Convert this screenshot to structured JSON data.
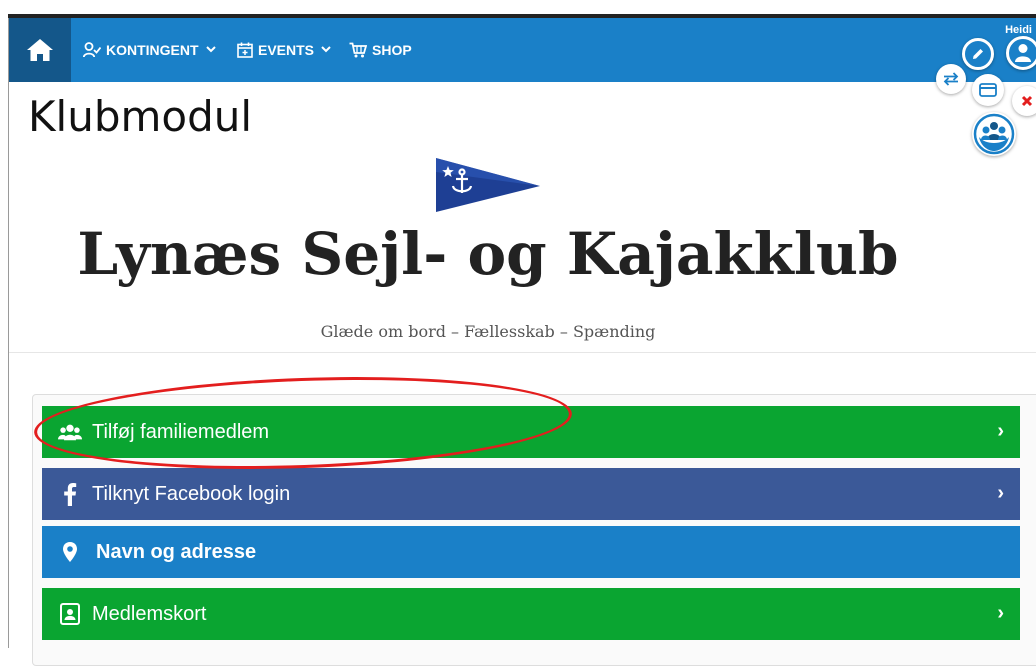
{
  "nav": {
    "items": [
      {
        "label": "KONTINGENT",
        "icon": "user-check-icon",
        "has_dropdown": true
      },
      {
        "label": "EVENTS",
        "icon": "calendar-icon",
        "has_dropdown": true
      },
      {
        "label": "SHOP",
        "icon": "cart-icon",
        "has_dropdown": false
      }
    ],
    "user_name": "Heidi"
  },
  "page": {
    "module_title": "Klubmodul",
    "club_name": "Lynæs Sejl- og Kajakklub",
    "tagline": "Glæde om bord – Fællesskab – Spænding"
  },
  "menu": [
    {
      "label": "Tilføj familiemedlem",
      "icon": "family-icon",
      "color": "#0aa531",
      "arrow": "›"
    },
    {
      "label": "Tilknyt Facebook login",
      "icon": "facebook-icon",
      "color": "#3b5998",
      "arrow": "›"
    },
    {
      "label": "Navn og adresse",
      "icon": "map-pin-icon",
      "color": "#1a80c8",
      "arrow": ""
    },
    {
      "label": "Medlemskort",
      "icon": "member-card-icon",
      "color": "#0aa531",
      "arrow": "›"
    }
  ],
  "colors": {
    "navbar": "#1a80c8",
    "home_button": "#14578a",
    "highlight_oval": "#e31e1e"
  }
}
